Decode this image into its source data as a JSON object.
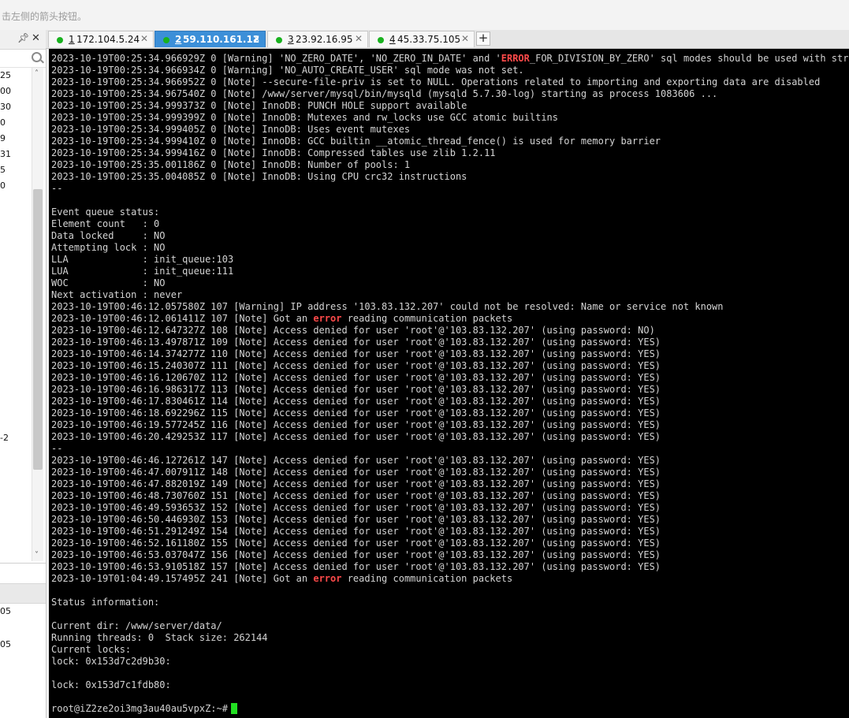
{
  "hint": {
    "text": "击左侧的箭头按钮。"
  },
  "left_panel": {
    "items_top": [
      "25",
      "00",
      "30",
      "0",
      "9",
      "31",
      "5",
      "0"
    ],
    "item_mid": "-2",
    "items_bottom": [
      "05",
      "05"
    ]
  },
  "tabs": [
    {
      "num": "1",
      "label": "172.104.5.24",
      "active": false
    },
    {
      "num": "2",
      "label": "59.110.161.12",
      "active": true
    },
    {
      "num": "3",
      "label": "23.92.16.95",
      "active": false
    },
    {
      "num": "4",
      "label": "45.33.75.105",
      "active": false
    }
  ],
  "terminal": {
    "lines": [
      {
        "before": "2023-10-19T00:25:34.966929Z 0 [Warning] 'NO_ZERO_DATE', 'NO_ZERO_IN_DATE' and '",
        "hl": "ERROR",
        "after": "_FOR_DIVISION_BY_ZERO' sql modes should be used with strict mode."
      },
      {
        "before": "2023-10-19T00:25:34.966934Z 0 [Warning] 'NO_AUTO_CREATE_USER' sql mode was not set."
      },
      {
        "before": "2023-10-19T00:25:34.966952Z 0 [Note] --secure-file-priv is set to NULL. Operations related to importing and exporting data are disabled"
      },
      {
        "before": "2023-10-19T00:25:34.967540Z 0 [Note] /www/server/mysql/bin/mysqld (mysqld 5.7.30-log) starting as process 1083606 ..."
      },
      {
        "before": "2023-10-19T00:25:34.999373Z 0 [Note] InnoDB: PUNCH HOLE support available"
      },
      {
        "before": "2023-10-19T00:25:34.999399Z 0 [Note] InnoDB: Mutexes and rw_locks use GCC atomic builtins"
      },
      {
        "before": "2023-10-19T00:25:34.999405Z 0 [Note] InnoDB: Uses event mutexes"
      },
      {
        "before": "2023-10-19T00:25:34.999410Z 0 [Note] InnoDB: GCC builtin __atomic_thread_fence() is used for memory barrier"
      },
      {
        "before": "2023-10-19T00:25:34.999416Z 0 [Note] InnoDB: Compressed tables use zlib 1.2.11"
      },
      {
        "before": "2023-10-19T00:25:35.001186Z 0 [Note] InnoDB: Number of pools: 1"
      },
      {
        "before": "2023-10-19T00:25:35.004085Z 0 [Note] InnoDB: Using CPU crc32 instructions"
      },
      {
        "before": "--"
      },
      {
        "before": ""
      },
      {
        "before": "Event queue status:"
      },
      {
        "before": "Element count   : 0"
      },
      {
        "before": "Data locked     : NO"
      },
      {
        "before": "Attempting lock : NO"
      },
      {
        "before": "LLA             : init_queue:103"
      },
      {
        "before": "LUA             : init_queue:111"
      },
      {
        "before": "WOC             : NO"
      },
      {
        "before": "Next activation : never"
      },
      {
        "before": "2023-10-19T00:46:12.057580Z 107 [Warning] IP address '103.83.132.207' could not be resolved: Name or service not known"
      },
      {
        "before": "2023-10-19T00:46:12.061411Z 107 [Note] Got an ",
        "hl": "error",
        "after": " reading communication packets"
      },
      {
        "before": "2023-10-19T00:46:12.647327Z 108 [Note] Access denied for user 'root'@'103.83.132.207' (using password: NO)"
      },
      {
        "before": "2023-10-19T00:46:13.497871Z 109 [Note] Access denied for user 'root'@'103.83.132.207' (using password: YES)"
      },
      {
        "before": "2023-10-19T00:46:14.374277Z 110 [Note] Access denied for user 'root'@'103.83.132.207' (using password: YES)"
      },
      {
        "before": "2023-10-19T00:46:15.240307Z 111 [Note] Access denied for user 'root'@'103.83.132.207' (using password: YES)"
      },
      {
        "before": "2023-10-19T00:46:16.120670Z 112 [Note] Access denied for user 'root'@'103.83.132.207' (using password: YES)"
      },
      {
        "before": "2023-10-19T00:46:16.986317Z 113 [Note] Access denied for user 'root'@'103.83.132.207' (using password: YES)"
      },
      {
        "before": "2023-10-19T00:46:17.830461Z 114 [Note] Access denied for user 'root'@'103.83.132.207' (using password: YES)"
      },
      {
        "before": "2023-10-19T00:46:18.692296Z 115 [Note] Access denied for user 'root'@'103.83.132.207' (using password: YES)"
      },
      {
        "before": "2023-10-19T00:46:19.577245Z 116 [Note] Access denied for user 'root'@'103.83.132.207' (using password: YES)"
      },
      {
        "before": "2023-10-19T00:46:20.429253Z 117 [Note] Access denied for user 'root'@'103.83.132.207' (using password: YES)"
      },
      {
        "before": "--"
      },
      {
        "before": "2023-10-19T00:46:46.127261Z 147 [Note] Access denied for user 'root'@'103.83.132.207' (using password: YES)"
      },
      {
        "before": "2023-10-19T00:46:47.007911Z 148 [Note] Access denied for user 'root'@'103.83.132.207' (using password: YES)"
      },
      {
        "before": "2023-10-19T00:46:47.882019Z 149 [Note] Access denied for user 'root'@'103.83.132.207' (using password: YES)"
      },
      {
        "before": "2023-10-19T00:46:48.730760Z 151 [Note] Access denied for user 'root'@'103.83.132.207' (using password: YES)"
      },
      {
        "before": "2023-10-19T00:46:49.593653Z 152 [Note] Access denied for user 'root'@'103.83.132.207' (using password: YES)"
      },
      {
        "before": "2023-10-19T00:46:50.446930Z 153 [Note] Access denied for user 'root'@'103.83.132.207' (using password: YES)"
      },
      {
        "before": "2023-10-19T00:46:51.291249Z 154 [Note] Access denied for user 'root'@'103.83.132.207' (using password: YES)"
      },
      {
        "before": "2023-10-19T00:46:52.161180Z 155 [Note] Access denied for user 'root'@'103.83.132.207' (using password: YES)"
      },
      {
        "before": "2023-10-19T00:46:53.037047Z 156 [Note] Access denied for user 'root'@'103.83.132.207' (using password: YES)"
      },
      {
        "before": "2023-10-19T00:46:53.910518Z 157 [Note] Access denied for user 'root'@'103.83.132.207' (using password: YES)"
      },
      {
        "before": "2023-10-19T01:04:49.157495Z 241 [Note] Got an ",
        "hl": "error",
        "after": " reading communication packets"
      },
      {
        "before": ""
      },
      {
        "before": "Status information:"
      },
      {
        "before": ""
      },
      {
        "before": "Current dir: /www/server/data/"
      },
      {
        "before": "Running threads: 0  Stack size: 262144"
      },
      {
        "before": "Current locks:"
      },
      {
        "before": "lock: 0x153d7c2d9b30:"
      },
      {
        "before": ""
      },
      {
        "before": "lock: 0x153d7c1fdb80:"
      },
      {
        "before": ""
      }
    ],
    "prompt": "root@iZ2ze2oi3mg3au40au5vpxZ:~#"
  },
  "colors": {
    "tab_active": "#3c8fd8",
    "connected_dot": "#19b21f",
    "error_highlight": "#ff4a4a",
    "cursor": "#22e022"
  }
}
